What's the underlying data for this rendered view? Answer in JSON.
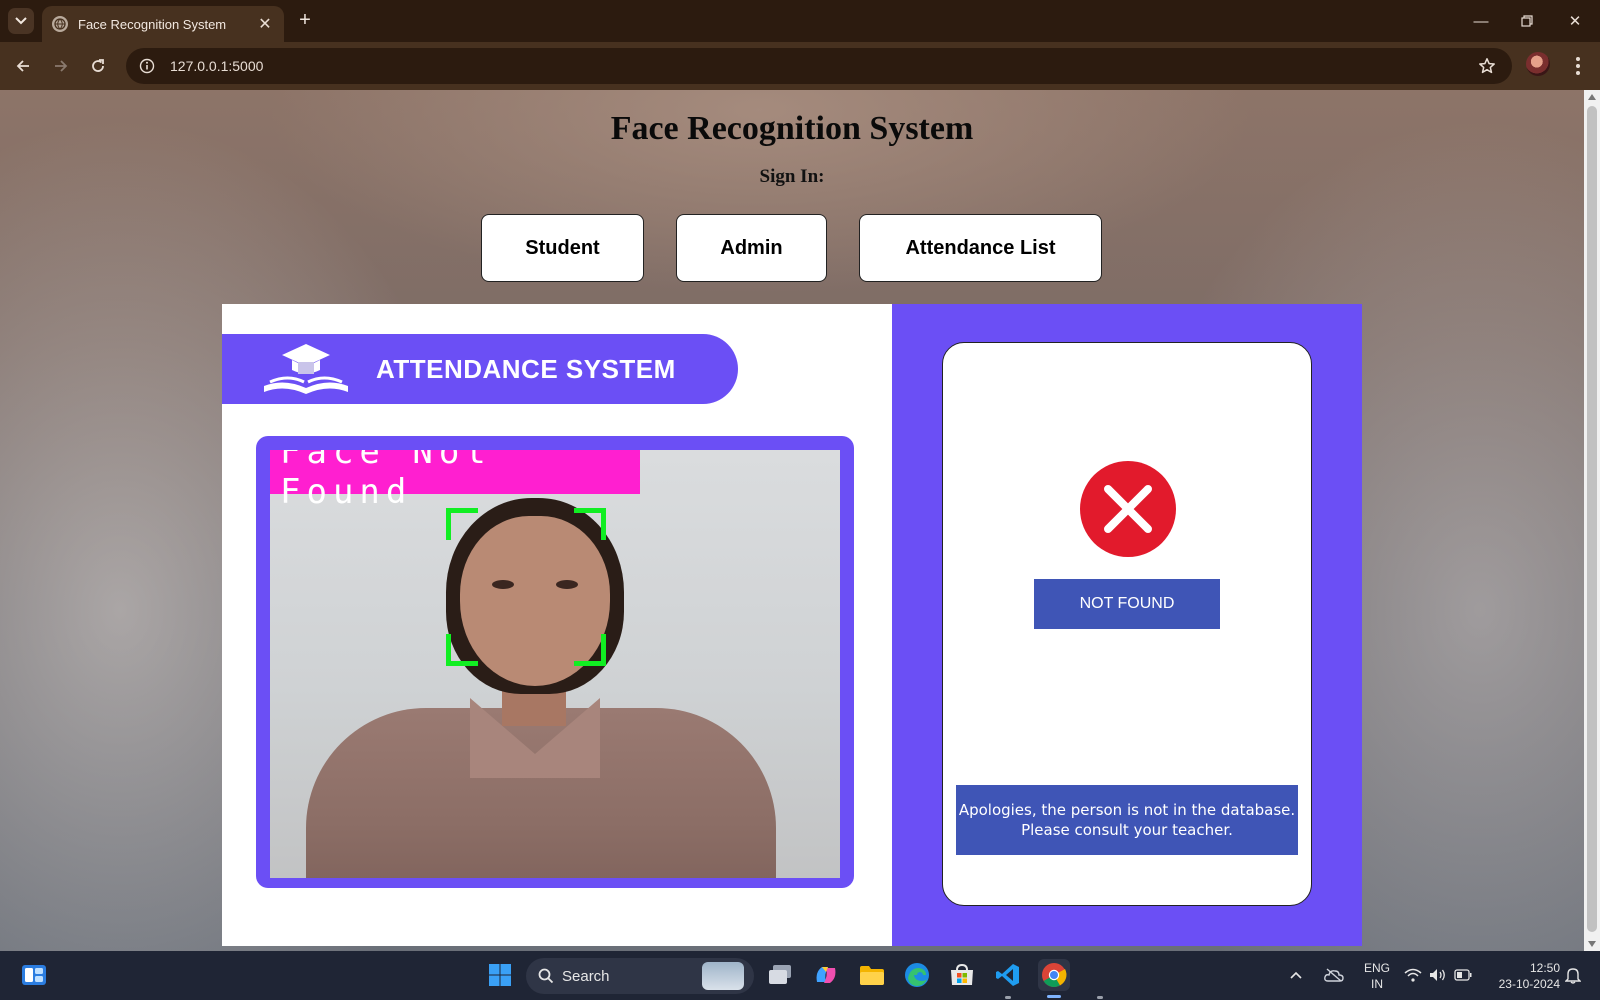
{
  "browser": {
    "tab_title": "Face Recognition System",
    "new_tab_symbol": "+",
    "url": "127.0.0.1:5000",
    "icons": [
      "tab-search-icon",
      "globe-icon",
      "close-icon",
      "back-arrow-icon",
      "forward-arrow-icon",
      "reload-icon",
      "info-icon",
      "star-icon",
      "profile-avatar",
      "menu-dots-icon",
      "minimize-icon",
      "restore-icon",
      "window-close-icon"
    ]
  },
  "page": {
    "title": "Face Recognition System",
    "sign_in_label": "Sign In:",
    "nav_buttons": [
      {
        "label": "Student"
      },
      {
        "label": "Admin"
      },
      {
        "label": "Attendance List"
      }
    ]
  },
  "attendance": {
    "banner_title": "ATTENDANCE SYSTEM",
    "camera_status": "Face Not Found",
    "result_label": "NOT FOUND",
    "message_line1": "Apologies, the person is not in the database.",
    "message_line2": "Please consult your teacher."
  },
  "colors": {
    "accent_purple": "#6b4ff5",
    "badge_blue": "#3f55b6",
    "error_red": "#e21a2c",
    "overlay_magenta": "#ff1fd0",
    "face_box_green": "#11ee22"
  },
  "taskbar": {
    "search_label": "Search",
    "language_line1": "ENG",
    "language_line2": "IN",
    "time": "12:50",
    "date": "23-10-2024",
    "pinned_apps": [
      "widgets-icon",
      "windows-start-icon",
      "task-view-icon",
      "copilot-icon",
      "file-explorer-icon",
      "edge-icon",
      "microsoft-store-icon",
      "vscode-icon",
      "chrome-icon"
    ]
  }
}
